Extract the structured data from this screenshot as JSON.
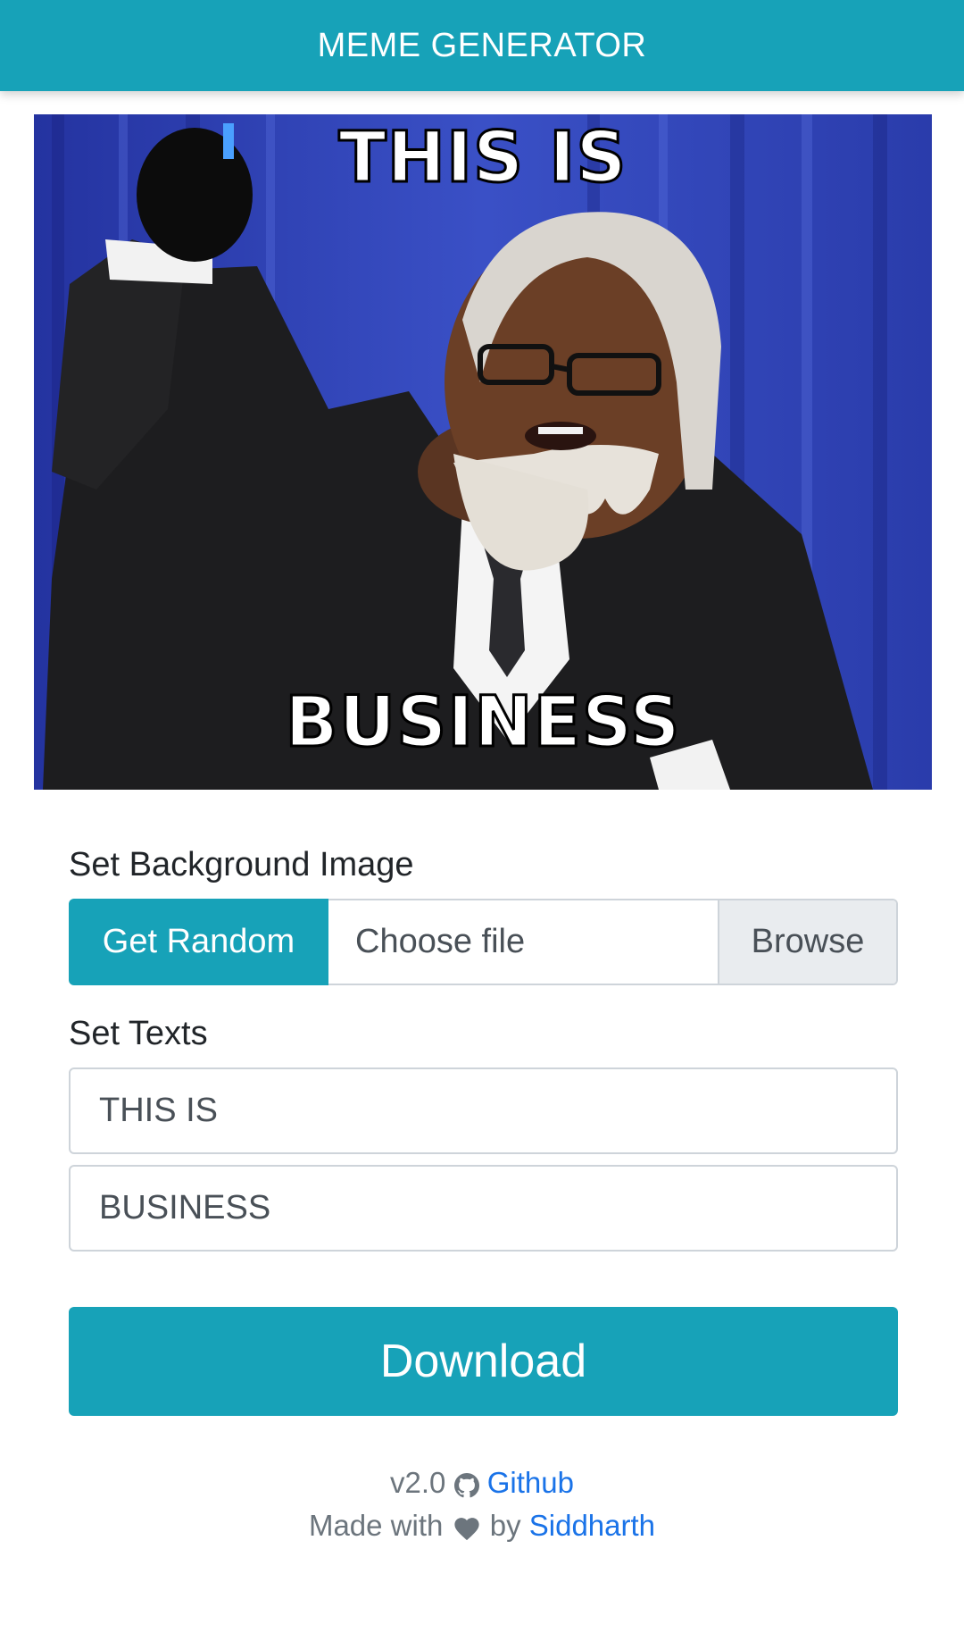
{
  "navbar": {
    "title": "MEME GENERATOR",
    "color": "#17a2b8"
  },
  "meme": {
    "top_text": "THIS IS",
    "bottom_text": "BUSINESS"
  },
  "background_section": {
    "label": "Set Background Image",
    "random_button": "Get Random",
    "file_placeholder": "Choose file",
    "browse_button": "Browse"
  },
  "texts_section": {
    "label": "Set Texts",
    "top_value": "THIS IS",
    "bottom_value": "BUSINESS"
  },
  "download_button": "Download",
  "footer": {
    "version": "v2.0",
    "github_icon": "github-icon",
    "github_link": "Github",
    "made_with": "Made with",
    "heart_icon": "heart-icon",
    "by": "by",
    "author_link": "Siddharth"
  }
}
